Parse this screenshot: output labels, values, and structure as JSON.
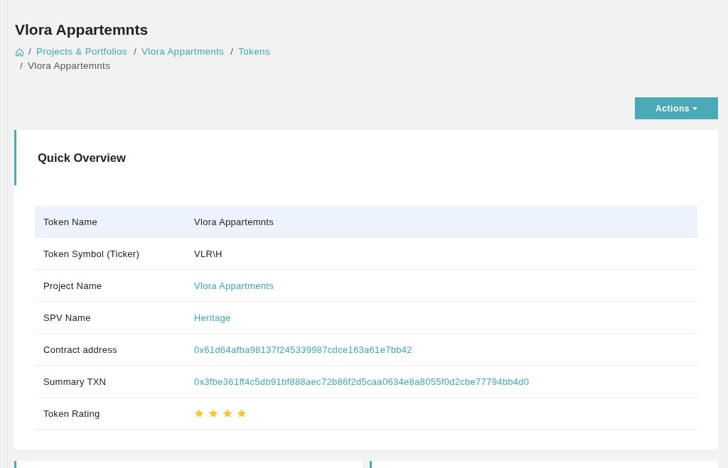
{
  "page_title": "Vlora Appartemnts",
  "breadcrumb_separator": "/",
  "breadcrumb": [
    {
      "label": "Projects & Portfolios",
      "link": true
    },
    {
      "label": "Vlora Appartments",
      "link": true
    },
    {
      "label": "Tokens",
      "link": true
    },
    {
      "label": "Vlora Appartemnts",
      "link": false
    }
  ],
  "actions_button": "Actions",
  "card": {
    "title": "Quick Overview",
    "rows": [
      {
        "label": "Token Name",
        "kind": "text",
        "value": "Vlora Appartemnts",
        "selected": true
      },
      {
        "label": "Token Symbol (Ticker)",
        "kind": "text",
        "value": "VLR\\H",
        "selected": false
      },
      {
        "label": "Project Name",
        "kind": "link",
        "value": "Vlora Appartments",
        "selected": false
      },
      {
        "label": "SPV Name",
        "kind": "link",
        "value": "Heritage",
        "selected": false
      },
      {
        "label": "Contract address",
        "kind": "link",
        "value": "0x61d64afba98137f245339987cdce163a61e7bb42",
        "selected": false
      },
      {
        "label": "Summary TXN",
        "kind": "link",
        "value": "0x3fbe361ff4c5db91bf888aec72b86f2d5caa0634e8a8055f0d2cbe77794bb4d0",
        "selected": false
      },
      {
        "label": "Token Rating",
        "kind": "stars",
        "stars": 4,
        "selected": false
      }
    ]
  }
}
